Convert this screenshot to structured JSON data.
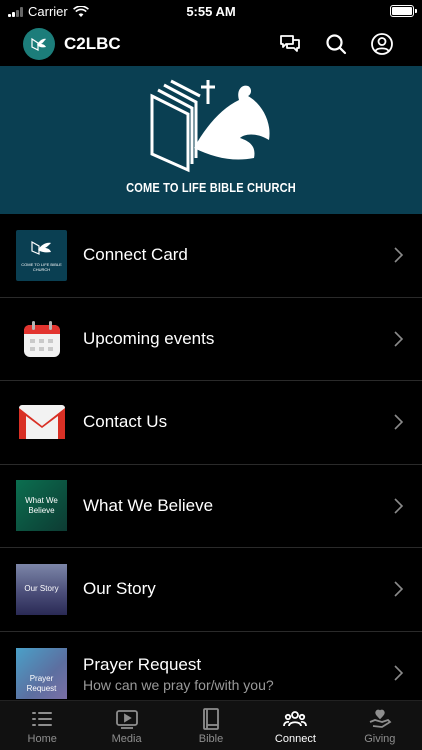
{
  "status_bar": {
    "carrier": "Carrier",
    "time": "5:55 AM"
  },
  "header": {
    "title": "C2LBC"
  },
  "banner": {
    "caption": "COME TO LIFE BIBLE CHURCH"
  },
  "thumbnails": {
    "connect_caption": "COME TO LIFE BIBLE CHURCH",
    "believe_caption": "What We Believe",
    "story_caption": "Our Story",
    "prayer_caption": "Prayer Request"
  },
  "list": {
    "items": [
      {
        "title": "Connect Card",
        "subtitle": ""
      },
      {
        "title": "Upcoming events",
        "subtitle": ""
      },
      {
        "title": "Contact Us",
        "subtitle": ""
      },
      {
        "title": "What We Believe",
        "subtitle": ""
      },
      {
        "title": "Our Story",
        "subtitle": ""
      },
      {
        "title": "Prayer Request",
        "subtitle": "How can we pray for/with you?"
      }
    ]
  },
  "tabs": [
    {
      "label": "Home",
      "icon": "list-icon"
    },
    {
      "label": "Media",
      "icon": "play-icon"
    },
    {
      "label": "Bible",
      "icon": "book-icon"
    },
    {
      "label": "Connect",
      "icon": "people-icon",
      "active": true
    },
    {
      "label": "Giving",
      "icon": "giving-hand-icon"
    }
  ],
  "colors": {
    "banner": "#0a3f52",
    "logo": "#1c7d7a",
    "background": "#000000"
  }
}
